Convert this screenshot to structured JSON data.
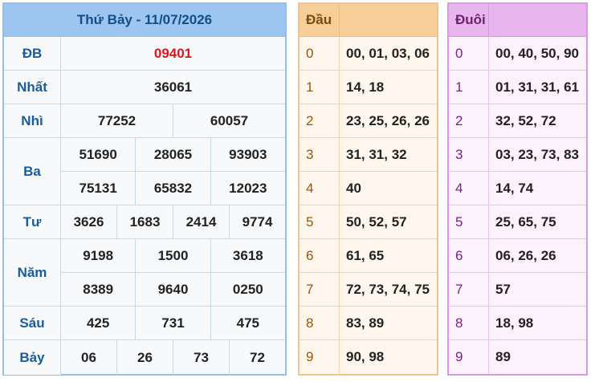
{
  "header": {
    "title": "Thứ Bảy - 11/07/2026"
  },
  "prizes": {
    "db": {
      "label": "ĐB",
      "values": [
        "09401"
      ]
    },
    "nhat": {
      "label": "Nhất",
      "values": [
        "36061"
      ]
    },
    "nhi": {
      "label": "Nhì",
      "values": [
        "77252",
        "60057"
      ]
    },
    "ba": {
      "label": "Ba",
      "rows": [
        [
          "51690",
          "28065",
          "93903"
        ],
        [
          "75131",
          "65832",
          "12023"
        ]
      ]
    },
    "tu": {
      "label": "Tư",
      "values": [
        "3626",
        "1683",
        "2414",
        "9774"
      ]
    },
    "nam": {
      "label": "Năm",
      "rows": [
        [
          "9198",
          "1500",
          "3618"
        ],
        [
          "8389",
          "9640",
          "0250"
        ]
      ]
    },
    "sau": {
      "label": "Sáu",
      "values": [
        "425",
        "731",
        "475"
      ]
    },
    "bay": {
      "label": "Bảy",
      "values": [
        "06",
        "26",
        "73",
        "72"
      ]
    }
  },
  "dau": {
    "title": "Đầu",
    "rows": [
      {
        "k": "0",
        "v": "00, 01, 03, 06"
      },
      {
        "k": "1",
        "v": "14, 18"
      },
      {
        "k": "2",
        "v": "23, 25, 26, 26"
      },
      {
        "k": "3",
        "v": "31, 31, 32"
      },
      {
        "k": "4",
        "v": "40"
      },
      {
        "k": "5",
        "v": "50, 52, 57"
      },
      {
        "k": "6",
        "v": "61, 65"
      },
      {
        "k": "7",
        "v": "72, 73, 74, 75"
      },
      {
        "k": "8",
        "v": "83, 89"
      },
      {
        "k": "9",
        "v": "90, 98"
      }
    ]
  },
  "duoi": {
    "title": "Đuôi",
    "rows": [
      {
        "k": "0",
        "v": "00, 40, 50, 90"
      },
      {
        "k": "1",
        "v": "01, 31, 31, 61"
      },
      {
        "k": "2",
        "v": "32, 52, 72"
      },
      {
        "k": "3",
        "v": "03, 23, 73, 83"
      },
      {
        "k": "4",
        "v": "14, 74"
      },
      {
        "k": "5",
        "v": "25, 65, 75"
      },
      {
        "k": "6",
        "v": "06, 26, 26"
      },
      {
        "k": "7",
        "v": "57"
      },
      {
        "k": "8",
        "v": "18, 98"
      },
      {
        "k": "9",
        "v": "89"
      }
    ]
  },
  "colors": {
    "special_prize": "#e0121a",
    "label": "#1a5c99",
    "header_bg": "#9cc5f0"
  }
}
